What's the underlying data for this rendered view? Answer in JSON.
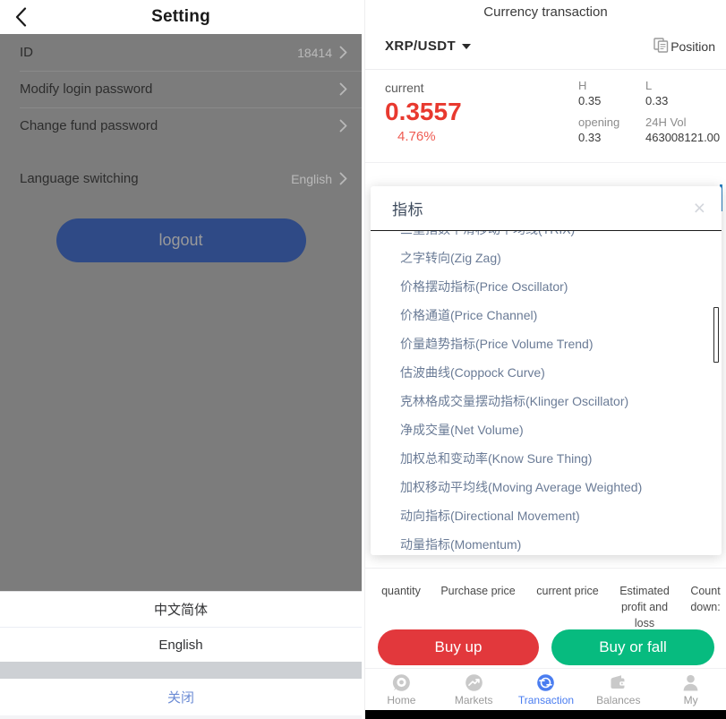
{
  "left": {
    "header": {
      "title": "Setting",
      "back_icon": "chevron-left-icon"
    },
    "rows": [
      {
        "label": "ID",
        "value": "18414",
        "chevron": "chevron-right-icon"
      },
      {
        "label": "Modify login password",
        "value": "",
        "chevron": "chevron-right-icon"
      },
      {
        "label": "Change fund password",
        "value": "",
        "chevron": "chevron-right-icon"
      }
    ],
    "language_row": {
      "label": "Language switching",
      "value": "English",
      "chevron": "chevron-right-icon"
    },
    "logout_label": "logout",
    "sheet": {
      "options": [
        "中文简体",
        "English"
      ],
      "cancel_label": "关闭"
    }
  },
  "right": {
    "title": "Currency transaction",
    "pair": "XRP/USDT",
    "pair_caret_icon": "caret-down-icon",
    "position_label": "Position",
    "position_icon": "copy-documents-icon",
    "quote": {
      "current_label": "current",
      "price": "0.3557",
      "change_pct": "4.76%",
      "stats": [
        {
          "key": "H",
          "value": "0.35"
        },
        {
          "key": "L",
          "value": "0.33"
        },
        {
          "key": "opening",
          "value": "0.33"
        },
        {
          "key": "24H Vol",
          "value": "463008121.00"
        }
      ]
    },
    "modal": {
      "title": "指标",
      "close_icon": "close-x-icon",
      "items": [
        "三重指数平滑移动平均线(TRIX)",
        "之字转向(Zig Zag)",
        "价格摆动指标(Price Oscillator)",
        "价格通道(Price Channel)",
        "价量趋势指标(Price Volume Trend)",
        "估波曲线(Coppock Curve)",
        "克林格成交量摆动指标(Klinger Oscillator)",
        "净成交量(Net Volume)",
        "加权总和变动率(Know Sure Thing)",
        "加权移动平均线(Moving Average Weighted)",
        "动向指标(Directional Movement)",
        "动量指标(Momentum)"
      ]
    },
    "order_table": {
      "headers": [
        "quantity",
        "Purchase price",
        "current price",
        "Estimated profit and loss",
        "Count down:"
      ]
    },
    "trade": {
      "buy_up_label": "Buy up",
      "buy_fall_label": "Buy or fall",
      "buy_up_color": "#e2383c",
      "buy_fall_color": "#07bb7f"
    },
    "tabs": [
      {
        "label": "Home",
        "icon": "home-target-icon",
        "active": false
      },
      {
        "label": "Markets",
        "icon": "trend-chart-icon",
        "active": false
      },
      {
        "label": "Transaction",
        "icon": "exchange-circle-icon",
        "active": true
      },
      {
        "label": "Balances",
        "icon": "wallet-icon",
        "active": false
      },
      {
        "label": "My",
        "icon": "user-person-icon",
        "active": false
      }
    ],
    "accent_color": "#4a7df0"
  }
}
